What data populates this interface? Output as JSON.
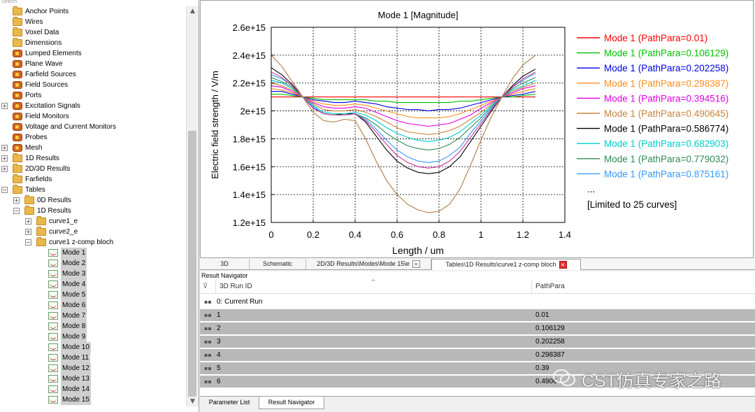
{
  "tree": {
    "search_hint": "Search",
    "items": [
      {
        "label": "Anchor Points",
        "level": 0,
        "icon": "folder",
        "expander": "",
        "selected": false
      },
      {
        "label": "Wires",
        "level": 0,
        "icon": "folder",
        "expander": "",
        "selected": false
      },
      {
        "label": "Voxel Data",
        "level": 0,
        "icon": "folder",
        "expander": "",
        "selected": false
      },
      {
        "label": "Dimensions",
        "level": 0,
        "icon": "folder",
        "expander": "",
        "selected": false
      },
      {
        "label": "Lumped Elements",
        "level": 0,
        "icon": "gear",
        "expander": "",
        "selected": false
      },
      {
        "label": "Plane Wave",
        "level": 0,
        "icon": "gear",
        "expander": "",
        "selected": false
      },
      {
        "label": "Farfield Sources",
        "level": 0,
        "icon": "gear",
        "expander": "",
        "selected": false
      },
      {
        "label": "Field Sources",
        "level": 0,
        "icon": "gear",
        "expander": "",
        "selected": false
      },
      {
        "label": "Ports",
        "level": 0,
        "icon": "gear",
        "expander": "",
        "selected": false
      },
      {
        "label": "Excitation Signals",
        "level": 0,
        "icon": "gear",
        "expander": "+",
        "selected": false
      },
      {
        "label": "Field Monitors",
        "level": 0,
        "icon": "gear",
        "expander": "",
        "selected": false
      },
      {
        "label": "Voltage and Current Monitors",
        "level": 0,
        "icon": "gear",
        "expander": "",
        "selected": false
      },
      {
        "label": "Probes",
        "level": 0,
        "icon": "gear",
        "expander": "",
        "selected": false
      },
      {
        "label": "Mesh",
        "level": 0,
        "icon": "gear",
        "expander": "+",
        "selected": false
      },
      {
        "label": "1D Results",
        "level": 0,
        "icon": "folder",
        "expander": "+",
        "selected": false
      },
      {
        "label": "2D/3D Results",
        "level": 0,
        "icon": "folder",
        "expander": "+",
        "selected": false
      },
      {
        "label": "Farfields",
        "level": 0,
        "icon": "folder",
        "expander": "",
        "selected": false
      },
      {
        "label": "Tables",
        "level": 0,
        "icon": "folder",
        "expander": "−",
        "selected": false
      },
      {
        "label": "0D Results",
        "level": 1,
        "icon": "folder",
        "expander": "+",
        "selected": false
      },
      {
        "label": "1D Results",
        "level": 1,
        "icon": "folder",
        "expander": "−",
        "selected": false
      },
      {
        "label": "curve1_e",
        "level": 2,
        "icon": "folder",
        "expander": "+",
        "selected": false
      },
      {
        "label": "curve2_e",
        "level": 2,
        "icon": "folder",
        "expander": "+",
        "selected": false
      },
      {
        "label": "curve1 z-comp bloch",
        "level": 2,
        "icon": "folder",
        "expander": "−",
        "selected": false
      },
      {
        "label": "Mode 1",
        "level": 3,
        "icon": "curve",
        "expander": "",
        "selected": true
      },
      {
        "label": "Mode 2",
        "level": 3,
        "icon": "curve",
        "expander": "",
        "selected": true
      },
      {
        "label": "Mode 3",
        "level": 3,
        "icon": "curve",
        "expander": "",
        "selected": true
      },
      {
        "label": "Mode 4",
        "level": 3,
        "icon": "curve",
        "expander": "",
        "selected": true
      },
      {
        "label": "Mode 5",
        "level": 3,
        "icon": "curve",
        "expander": "",
        "selected": true
      },
      {
        "label": "Mode 6",
        "level": 3,
        "icon": "curve",
        "expander": "",
        "selected": true
      },
      {
        "label": "Mode 7",
        "level": 3,
        "icon": "curve",
        "expander": "",
        "selected": true
      },
      {
        "label": "Mode 8",
        "level": 3,
        "icon": "curve",
        "expander": "",
        "selected": true
      },
      {
        "label": "Mode 9",
        "level": 3,
        "icon": "curve",
        "expander": "",
        "selected": true
      },
      {
        "label": "Mode 10",
        "level": 3,
        "icon": "curve",
        "expander": "",
        "selected": true
      },
      {
        "label": "Mode 11",
        "level": 3,
        "icon": "curve",
        "expander": "",
        "selected": true
      },
      {
        "label": "Mode 12",
        "level": 3,
        "icon": "curve",
        "expander": "",
        "selected": true
      },
      {
        "label": "Mode 13",
        "level": 3,
        "icon": "curve",
        "expander": "",
        "selected": true
      },
      {
        "label": "Mode 14",
        "level": 3,
        "icon": "curve",
        "expander": "",
        "selected": true
      },
      {
        "label": "Mode 15",
        "level": 3,
        "icon": "curve",
        "expander": "",
        "selected": true
      }
    ]
  },
  "chart_data": {
    "type": "line",
    "title": "Mode 1 [Magnitude]",
    "xlabel": "Length / um",
    "ylabel": "Electric field strength / V/m",
    "xlim": [
      0,
      1.4
    ],
    "ylim": [
      1200000000000000.0,
      2600000000000000.0
    ],
    "x_ticks": [
      0,
      0.2,
      0.4,
      0.6,
      0.8,
      1,
      1.2,
      1.4
    ],
    "x_tick_labels": [
      "0",
      "0.2",
      "0.4",
      "0.6",
      "0.8",
      "1",
      "1.2",
      "1.4"
    ],
    "y_ticks": [
      1200000000000000.0,
      1400000000000000.0,
      1600000000000000.0,
      1800000000000000.0,
      2000000000000000.0,
      2200000000000000.0,
      2400000000000000.0,
      2600000000000000.0
    ],
    "y_tick_labels": [
      "1.2e+15",
      "1.4e+15",
      "1.6e+15",
      "1.8e+15",
      "2e+15",
      "2.2e+15",
      "2.4e+15",
      "2.6e+15"
    ],
    "grid": true,
    "legend_position": "right",
    "legend_extra": [
      "...",
      "[Limited to 25 curves]"
    ],
    "x": [
      0,
      0.05,
      0.1,
      0.15,
      0.2,
      0.25,
      0.3,
      0.35,
      0.4,
      0.45,
      0.5,
      0.55,
      0.6,
      0.65,
      0.7,
      0.75,
      0.8,
      0.85,
      0.9,
      0.95,
      1.0,
      1.05,
      1.1,
      1.15,
      1.2,
      1.26
    ],
    "series": [
      {
        "name": "Mode 1 (PathPara=0.01)",
        "color": "#ff0000",
        "values": [
          2100000000000000.0,
          2100000000000000.0,
          2100000000000000.0,
          2100000000000000.0,
          2100000000000000.0,
          2100000000000000.0,
          2100000000000000.0,
          2100000000000000.0,
          2100000000000000.0,
          2100000000000000.0,
          2100000000000000.0,
          2100000000000000.0,
          2100000000000000.0,
          2100000000000000.0,
          2100000000000000.0,
          2100000000000000.0,
          2100000000000000.0,
          2100000000000000.0,
          2100000000000000.0,
          2100000000000000.0,
          2100000000000000.0,
          2100000000000000.0,
          2100000000000000.0,
          2100000000000000.0,
          2100000000000000.0,
          2100000000000000.0
        ]
      },
      {
        "name": "Mode 1 (PathPara=0.106129)",
        "color": "#00c000",
        "values": [
          2120000000000000.0,
          2120000000000000.0,
          2110000000000000.0,
          2100000000000000.0,
          2090000000000000.0,
          2080000000000000.0,
          2080000000000000.0,
          2080000000000000.0,
          2080000000000000.0,
          2080000000000000.0,
          2070000000000000.0,
          2070000000000000.0,
          2060000000000000.0,
          2060000000000000.0,
          2060000000000000.0,
          2060000000000000.0,
          2060000000000000.0,
          2060000000000000.0,
          2070000000000000.0,
          2070000000000000.0,
          2080000000000000.0,
          2090000000000000.0,
          2100000000000000.0,
          2100000000000000.0,
          2110000000000000.0,
          2120000000000000.0
        ]
      },
      {
        "name": "Mode 1 (PathPara=0.202258)",
        "color": "#0000e0",
        "values": [
          2140000000000000.0,
          2140000000000000.0,
          2120000000000000.0,
          2100000000000000.0,
          2080000000000000.0,
          2070000000000000.0,
          2060000000000000.0,
          2060000000000000.0,
          2070000000000000.0,
          2060000000000000.0,
          2050000000000000.0,
          2030000000000000.0,
          2020000000000000.0,
          2010000000000000.0,
          2010000000000000.0,
          2000000000000000.0,
          2010000000000000.0,
          2010000000000000.0,
          2020000000000000.0,
          2040000000000000.0,
          2060000000000000.0,
          2080000000000000.0,
          2100000000000000.0,
          2110000000000000.0,
          2120000000000000.0,
          2140000000000000.0
        ]
      },
      {
        "name": "Mode 1 (PathPara=0.298387)",
        "color": "#ff8c1a",
        "values": [
          2160000000000000.0,
          2150000000000000.0,
          2130000000000000.0,
          2100000000000000.0,
          2070000000000000.0,
          2050000000000000.0,
          2040000000000000.0,
          2040000000000000.0,
          2050000000000000.0,
          2040000000000000.0,
          2020000000000000.0,
          2000000000000000.0,
          1980000000000000.0,
          1960000000000000.0,
          1950000000000000.0,
          1950000000000000.0,
          1950000000000000.0,
          1960000000000000.0,
          1980000000000000.0,
          2010000000000000.0,
          2040000000000000.0,
          2070000000000000.0,
          2100000000000000.0,
          2120000000000000.0,
          2140000000000000.0,
          2160000000000000.0
        ]
      },
      {
        "name": "Mode 1 (PathPara=0.394516)",
        "color": "#e000e0",
        "values": [
          2180000000000000.0,
          2170000000000000.0,
          2140000000000000.0,
          2100000000000000.0,
          2060000000000000.0,
          2030000000000000.0,
          2020000000000000.0,
          2020000000000000.0,
          2030000000000000.0,
          2020000000000000.0,
          1990000000000000.0,
          1960000000000000.0,
          1930000000000000.0,
          1910000000000000.0,
          1900000000000000.0,
          1890000000000000.0,
          1900000000000000.0,
          1910000000000000.0,
          1940000000000000.0,
          1970000000000000.0,
          2020000000000000.0,
          2060000000000000.0,
          2100000000000000.0,
          2130000000000000.0,
          2160000000000000.0,
          2180000000000000.0
        ]
      },
      {
        "name": "Mode 1 (PathPara=0.490645)",
        "color": "#c8823c",
        "values": [
          2200000000000000.0,
          2180000000000000.0,
          2150000000000000.0,
          2100000000000000.0,
          2050000000000000.0,
          2010000000000000.0,
          2000000000000000.0,
          2000000000000000.0,
          2010000000000000.0,
          1990000000000000.0,
          1960000000000000.0,
          1920000000000000.0,
          1880000000000000.0,
          1850000000000000.0,
          1840000000000000.0,
          1830000000000000.0,
          1840000000000000.0,
          1860000000000000.0,
          1890000000000000.0,
          1940000000000000.0,
          1990000000000000.0,
          2050000000000000.0,
          2100000000000000.0,
          2140000000000000.0,
          2170000000000000.0,
          2200000000000000.0
        ]
      },
      {
        "name": "Mode 1 (PathPara=0.586774)",
        "color": "#000000",
        "values": [
          2310000000000000.0,
          2260000000000000.0,
          2190000000000000.0,
          2100000000000000.0,
          2020000000000000.0,
          1980000000000000.0,
          1970000000000000.0,
          1980000000000000.0,
          1980000000000000.0,
          1920000000000000.0,
          1820000000000000.0,
          1720000000000000.0,
          1640000000000000.0,
          1590000000000000.0,
          1560000000000000.0,
          1550000000000000.0,
          1560000000000000.0,
          1600000000000000.0,
          1670000000000000.0,
          1780000000000000.0,
          1890000000000000.0,
          2000000000000000.0,
          2100000000000000.0,
          2180000000000000.0,
          2250000000000000.0,
          2300000000000000.0
        ]
      },
      {
        "name": "Mode 1 (PathPara=0.682903)",
        "color": "#00cccc",
        "values": [
          2220000000000000.0,
          2200000000000000.0,
          2160000000000000.0,
          2100000000000000.0,
          2040000000000000.0,
          1990000000000000.0,
          1980000000000000.0,
          1980000000000000.0,
          1990000000000000.0,
          1970000000000000.0,
          1930000000000000.0,
          1880000000000000.0,
          1840000000000000.0,
          1810000000000000.0,
          1790000000000000.0,
          1780000000000000.0,
          1790000000000000.0,
          1810000000000000.0,
          1850000000000000.0,
          1910000000000000.0,
          1970000000000000.0,
          2040000000000000.0,
          2100000000000000.0,
          2150000000000000.0,
          2180000000000000.0,
          2220000000000000.0
        ]
      },
      {
        "name": "Mode 1 (PathPara=0.779032)",
        "color": "#2e8b57",
        "values": [
          2240000000000000.0,
          2210000000000000.0,
          2170000000000000.0,
          2100000000000000.0,
          2030000000000000.0,
          1980000000000000.0,
          1970000000000000.0,
          1970000000000000.0,
          1980000000000000.0,
          1950000000000000.0,
          1900000000000000.0,
          1840000000000000.0,
          1790000000000000.0,
          1750000000000000.0,
          1730000000000000.0,
          1720000000000000.0,
          1730000000000000.0,
          1760000000000000.0,
          1810000000000000.0,
          1880000000000000.0,
          1950000000000000.0,
          2030000000000000.0,
          2100000000000000.0,
          2160000000000000.0,
          2200000000000000.0,
          2240000000000000.0
        ]
      },
      {
        "name": "Mode 1 (PathPara=0.875161)",
        "color": "#3399ff",
        "values": [
          2260000000000000.0,
          2230000000000000.0,
          2180000000000000.0,
          2100000000000000.0,
          2030000000000000.0,
          1980000000000000.0,
          1970000000000000.0,
          1970000000000000.0,
          1980000000000000.0,
          1940000000000000.0,
          1870000000000000.0,
          1790000000000000.0,
          1720000000000000.0,
          1670000000000000.0,
          1640000000000000.0,
          1630000000000000.0,
          1640000000000000.0,
          1680000000000000.0,
          1740000000000000.0,
          1840000000000000.0,
          1930000000000000.0,
          2020000000000000.0,
          2100000000000000.0,
          2170000000000000.0,
          2220000000000000.0,
          2270000000000000.0
        ]
      },
      {
        "name": "",
        "color": "#cc3399",
        "values": [
          2280000000000000.0,
          2240000000000000.0,
          2180000000000000.0,
          2100000000000000.0,
          2020000000000000.0,
          1980000000000000.0,
          1970000000000000.0,
          1970000000000000.0,
          1980000000000000.0,
          1930000000000000.0,
          1850000000000000.0,
          1760000000000000.0,
          1680000000000000.0,
          1630000000000000.0,
          1600000000000000.0,
          1590000000000000.0,
          1600000000000000.0,
          1640000000000000.0,
          1710000000000000.0,
          1810000000000000.0,
          1910000000000000.0,
          2010000000000000.0,
          2100000000000000.0,
          2170000000000000.0,
          2230000000000000.0,
          2280000000000000.0
        ]
      },
      {
        "name": "",
        "color": "#b07a40",
        "values": [
          2400000000000000.0,
          2320000000000000.0,
          2210000000000000.0,
          2100000000000000.0,
          1990000000000000.0,
          1930000000000000.0,
          1920000000000000.0,
          1940000000000000.0,
          1930000000000000.0,
          1800000000000000.0,
          1640000000000000.0,
          1500000000000000.0,
          1400000000000000.0,
          1330000000000000.0,
          1290000000000000.0,
          1270000000000000.0,
          1280000000000000.0,
          1330000000000000.0,
          1440000000000000.0,
          1610000000000000.0,
          1790000000000000.0,
          1960000000000000.0,
          2100000000000000.0,
          2230000000000000.0,
          2330000000000000.0,
          2400000000000000.0
        ]
      }
    ]
  },
  "tabs": {
    "items": [
      {
        "label": "3D",
        "close": "",
        "active": false
      },
      {
        "label": "Schematic",
        "close": "",
        "active": false
      },
      {
        "label": "2D/3D Results\\Modes\\Mode 15\\e",
        "close": "normal",
        "active": false
      },
      {
        "label": "Tables\\1D Results\\curve1 z-comp bloch",
        "close": "red",
        "active": true
      }
    ],
    "close_glyph": "×"
  },
  "navigator": {
    "title": "Result Navigator",
    "col_run": "3D Run ID",
    "col_para": "PathPara",
    "filter_glyph": "⊽",
    "sort_glyph": "^",
    "row_glyph": "▪▪",
    "rows": [
      {
        "id": "0: Current Run",
        "para": "",
        "grey": false
      },
      {
        "id": "1",
        "para": "0.01",
        "grey": true
      },
      {
        "id": "2",
        "para": "0.106129",
        "grey": true
      },
      {
        "id": "3",
        "para": "0.202258",
        "grey": true
      },
      {
        "id": "4",
        "para": "0.298387",
        "grey": true
      },
      {
        "id": "5",
        "para": "0.39",
        "grey": true
      },
      {
        "id": "6",
        "para": "0.4906",
        "grey": true
      }
    ]
  },
  "bottom_tabs": {
    "parameter_list": "Parameter List",
    "result_navigator": "Result Navigator"
  },
  "scroll": {
    "up": "▲",
    "down": "▼"
  },
  "watermark": {
    "text": "CST仿真专家之路"
  }
}
